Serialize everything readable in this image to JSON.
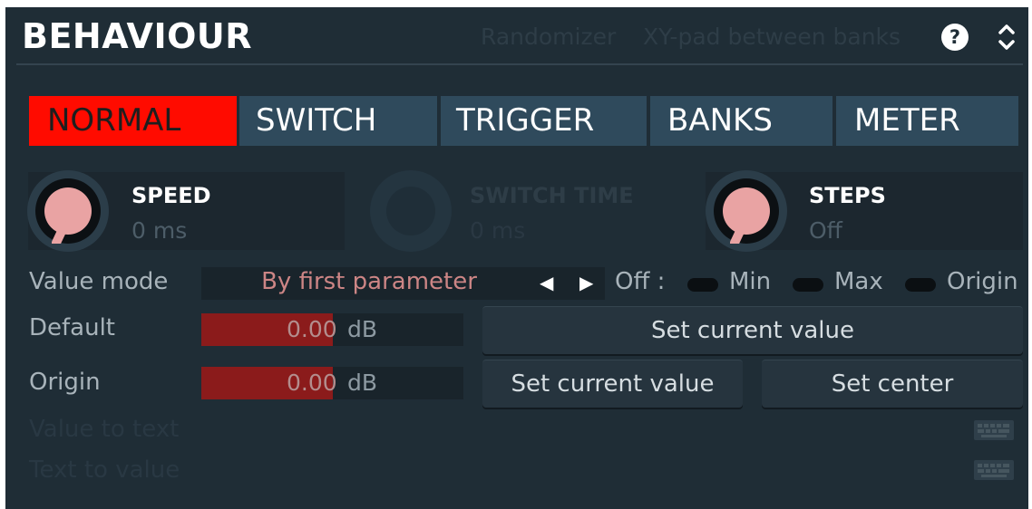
{
  "header": {
    "title": "BEHAVIOUR",
    "link_randomizer": "Randomizer",
    "link_xypad": "XY-pad between banks",
    "help_icon": "help-icon",
    "expand_icon": "expand-collapse-icon"
  },
  "tabs": [
    {
      "label": "NORMAL",
      "active": true
    },
    {
      "label": "SWITCH",
      "active": false
    },
    {
      "label": "TRIGGER",
      "active": false
    },
    {
      "label": "BANKS",
      "active": false
    },
    {
      "label": "METER",
      "active": false
    }
  ],
  "knobs": {
    "speed": {
      "label": "SPEED",
      "value": "0 ms",
      "enabled": true
    },
    "switch_time": {
      "label": "SWITCH TIME",
      "value": "0 ms",
      "enabled": false
    },
    "steps": {
      "label": "STEPS",
      "value": "Off",
      "enabled": true
    }
  },
  "value_mode": {
    "label": "Value mode",
    "value": "By first parameter",
    "prev_icon": "triangle-left-icon",
    "next_icon": "triangle-right-icon"
  },
  "toggles": {
    "off_label": "Off :",
    "items": [
      "Min",
      "Max",
      "Origin"
    ]
  },
  "default": {
    "label": "Default",
    "value": "0.00",
    "unit": "dB",
    "fill_fraction": 0.5,
    "button": "Set current value"
  },
  "origin": {
    "label": "Origin",
    "value": "0.00",
    "unit": "dB",
    "fill_fraction": 0.5,
    "button_current": "Set current value",
    "button_center": "Set center"
  },
  "value_to_text": {
    "label": "Value to text",
    "icon": "keyboard-icon"
  },
  "text_to_value": {
    "label": "Text to value",
    "icon": "keyboard-icon"
  },
  "colors": {
    "background": "#1f2d36",
    "tab_active": "#ff0b00",
    "tab_inactive": "#2f4a5c",
    "knob_indicator": "#e9a3a3",
    "slider_fill": "#8b1b1b",
    "value_text": "#cc8585"
  }
}
